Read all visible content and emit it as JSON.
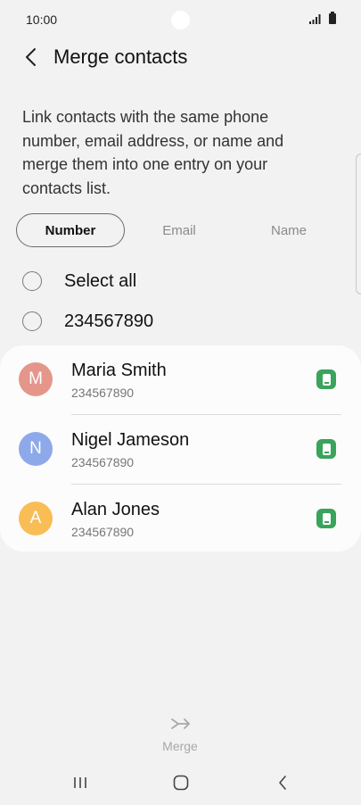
{
  "status": {
    "time": "10:00"
  },
  "header": {
    "title": "Merge contacts"
  },
  "description": "Link contacts with the same phone number, email address, or name and merge them into one entry on your contacts list.",
  "tabs": [
    {
      "label": "Number",
      "active": true
    },
    {
      "label": "Email",
      "active": false
    },
    {
      "label": "Name",
      "active": false
    }
  ],
  "select_all": {
    "label": "Select all"
  },
  "group": {
    "label": "234567890"
  },
  "contacts": [
    {
      "initial": "M",
      "name": "Maria Smith",
      "phone": "234567890",
      "avatar_color": "#e5968a"
    },
    {
      "initial": "N",
      "name": "Nigel Jameson",
      "phone": "234567890",
      "avatar_color": "#8ea9ea"
    },
    {
      "initial": "A",
      "name": "Alan Jones",
      "phone": "234567890",
      "avatar_color": "#f8bd55"
    }
  ],
  "merge": {
    "label": "Merge"
  },
  "colors": {
    "accent_badge": "#3aa35c",
    "background": "#f2f2f2"
  }
}
